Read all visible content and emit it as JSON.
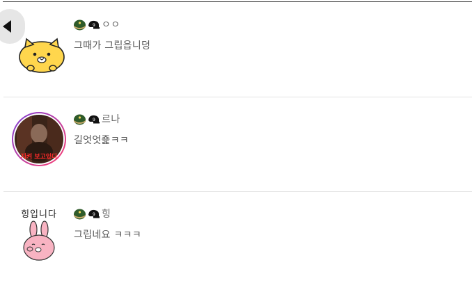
{
  "comments": [
    {
      "nickname": "ㅇㅇ",
      "message": "그때가 그립읍니덩",
      "avatar": "yellow-cat-sticker"
    },
    {
      "nickname": "르나",
      "message": "길엇엇죭ㅋㅋ",
      "avatar": "photo-story-ring",
      "avatar_caption": "지켜 보고있다"
    },
    {
      "nickname": "힝",
      "message": "그립네요 ㅋㅋㅋ",
      "avatar": "pink-bunny-sticker",
      "avatar_caption": "힝입니다"
    }
  ],
  "badges": [
    "army-helmet-badge",
    "black-cap-badge"
  ],
  "colors": {
    "story_ring_start": "#7b3fd6",
    "story_ring_end": "#ff3d6e",
    "cat": "#ffd64d",
    "bunny": "#f8b3c2"
  }
}
